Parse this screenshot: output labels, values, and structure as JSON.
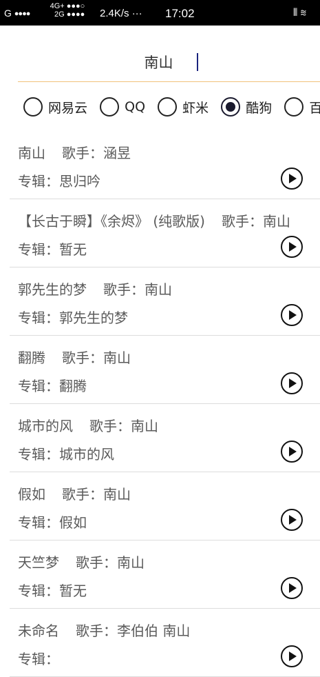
{
  "status_bar": {
    "carrier": "G",
    "signal_dots": "●●●●",
    "net_top": "4G+ ●●●○",
    "net_bottom": "2G ●●●●",
    "speed": "2.4K/s ···",
    "time": "17:02",
    "right_icons": "⫴ ≋"
  },
  "search": {
    "value": "南山",
    "accent_color": "#f0c27a"
  },
  "sources": {
    "selected": "酷狗",
    "options": [
      {
        "label": "网易云",
        "checked": false
      },
      {
        "label": "QQ",
        "checked": false
      },
      {
        "label": "虾米",
        "checked": false
      },
      {
        "label": "酷狗",
        "checked": true
      },
      {
        "label": "百",
        "checked": false
      }
    ]
  },
  "results": [
    {
      "title": "南山",
      "singer_label": "歌手：",
      "singer": "涵昱",
      "album_label": "专辑：",
      "album": "思归吟"
    },
    {
      "title": "【长古于瞬】《余烬》 (纯歌版)",
      "singer_label": "歌手：",
      "singer": "南山",
      "album_label": "专辑：",
      "album": "暂无"
    },
    {
      "title": "郭先生的梦",
      "singer_label": "歌手：",
      "singer": "南山",
      "album_label": "专辑：",
      "album": "郭先生的梦"
    },
    {
      "title": "翻腾",
      "singer_label": "歌手：",
      "singer": "南山",
      "album_label": "专辑：",
      "album": "翻腾"
    },
    {
      "title": "城市的风",
      "singer_label": "歌手：",
      "singer": "南山",
      "album_label": "专辑：",
      "album": "城市的风"
    },
    {
      "title": "假如",
      "singer_label": "歌手：",
      "singer": "南山",
      "album_label": "专辑：",
      "album": "假如"
    },
    {
      "title": "天竺梦",
      "singer_label": "歌手：",
      "singer": "南山",
      "album_label": "专辑：",
      "album": "暂无"
    },
    {
      "title": "未命名",
      "singer_label": "歌手：",
      "singer": "李伯伯 南山",
      "album_label": "专辑：",
      "album": ""
    }
  ]
}
